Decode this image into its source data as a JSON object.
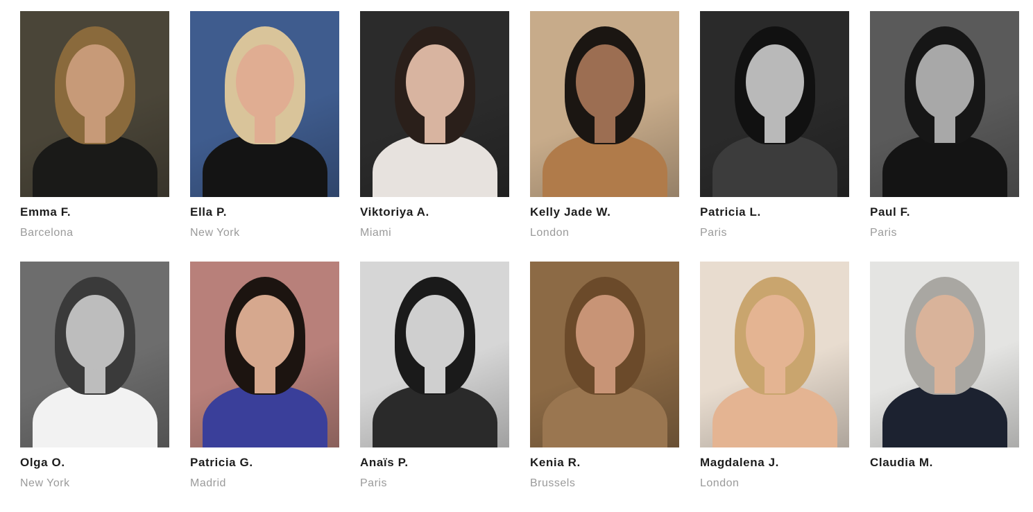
{
  "models": [
    {
      "name": "Emma F.",
      "city": "Barcelona",
      "bg": "#4a4538",
      "hair": "#8a6a3c",
      "skin": "#c79a78",
      "outfit": "#1a1a18"
    },
    {
      "name": "Ella P.",
      "city": "New York",
      "bg": "#3f5c8e",
      "hair": "#d9c49a",
      "skin": "#e0ad92",
      "outfit": "#141414"
    },
    {
      "name": "Viktoriya A.",
      "city": "Miami",
      "bg": "#2b2b2b",
      "hair": "#2a1f1a",
      "skin": "#d8b4a0",
      "outfit": "#e7e2de"
    },
    {
      "name": "Kelly Jade W.",
      "city": "London",
      "bg": "#c7ab8a",
      "hair": "#1b1612",
      "skin": "#9c6e52",
      "outfit": "#b07b4a"
    },
    {
      "name": "Patricia L.",
      "city": "Paris",
      "bg": "#2a2a2a",
      "hair": "#111111",
      "skin": "#b9b9b9",
      "outfit": "#3c3c3c"
    },
    {
      "name": "Paul F.",
      "city": "Paris",
      "bg": "#5a5a5a",
      "hair": "#161616",
      "skin": "#a8a8a8",
      "outfit": "#141414"
    },
    {
      "name": "Olga O.",
      "city": "New York",
      "bg": "#6d6d6d",
      "hair": "#3a3a3a",
      "skin": "#bdbdbd",
      "outfit": "#f2f2f2"
    },
    {
      "name": "Patricia G.",
      "city": "Madrid",
      "bg": "#b8807a",
      "hair": "#1c1410",
      "skin": "#d6a88e",
      "outfit": "#3a3f9a"
    },
    {
      "name": "Anaïs P.",
      "city": "Paris",
      "bg": "#d6d6d6",
      "hair": "#1a1a1a",
      "skin": "#cfcfcf",
      "outfit": "#2a2a2a"
    },
    {
      "name": "Kenia R.",
      "city": "Brussels",
      "bg": "#8c6a45",
      "hair": "#6b4a2a",
      "skin": "#c89476",
      "outfit": "#9a7650"
    },
    {
      "name": "Magdalena J.",
      "city": "London",
      "bg": "#e8dccf",
      "hair": "#c9a56e",
      "skin": "#e4b492",
      "outfit": "#e4b492"
    },
    {
      "name": "Claudia M.",
      "city": "",
      "bg": "#e4e4e2",
      "hair": "#a9a7a2",
      "skin": "#d9b39a",
      "outfit": "#1c2230"
    }
  ]
}
